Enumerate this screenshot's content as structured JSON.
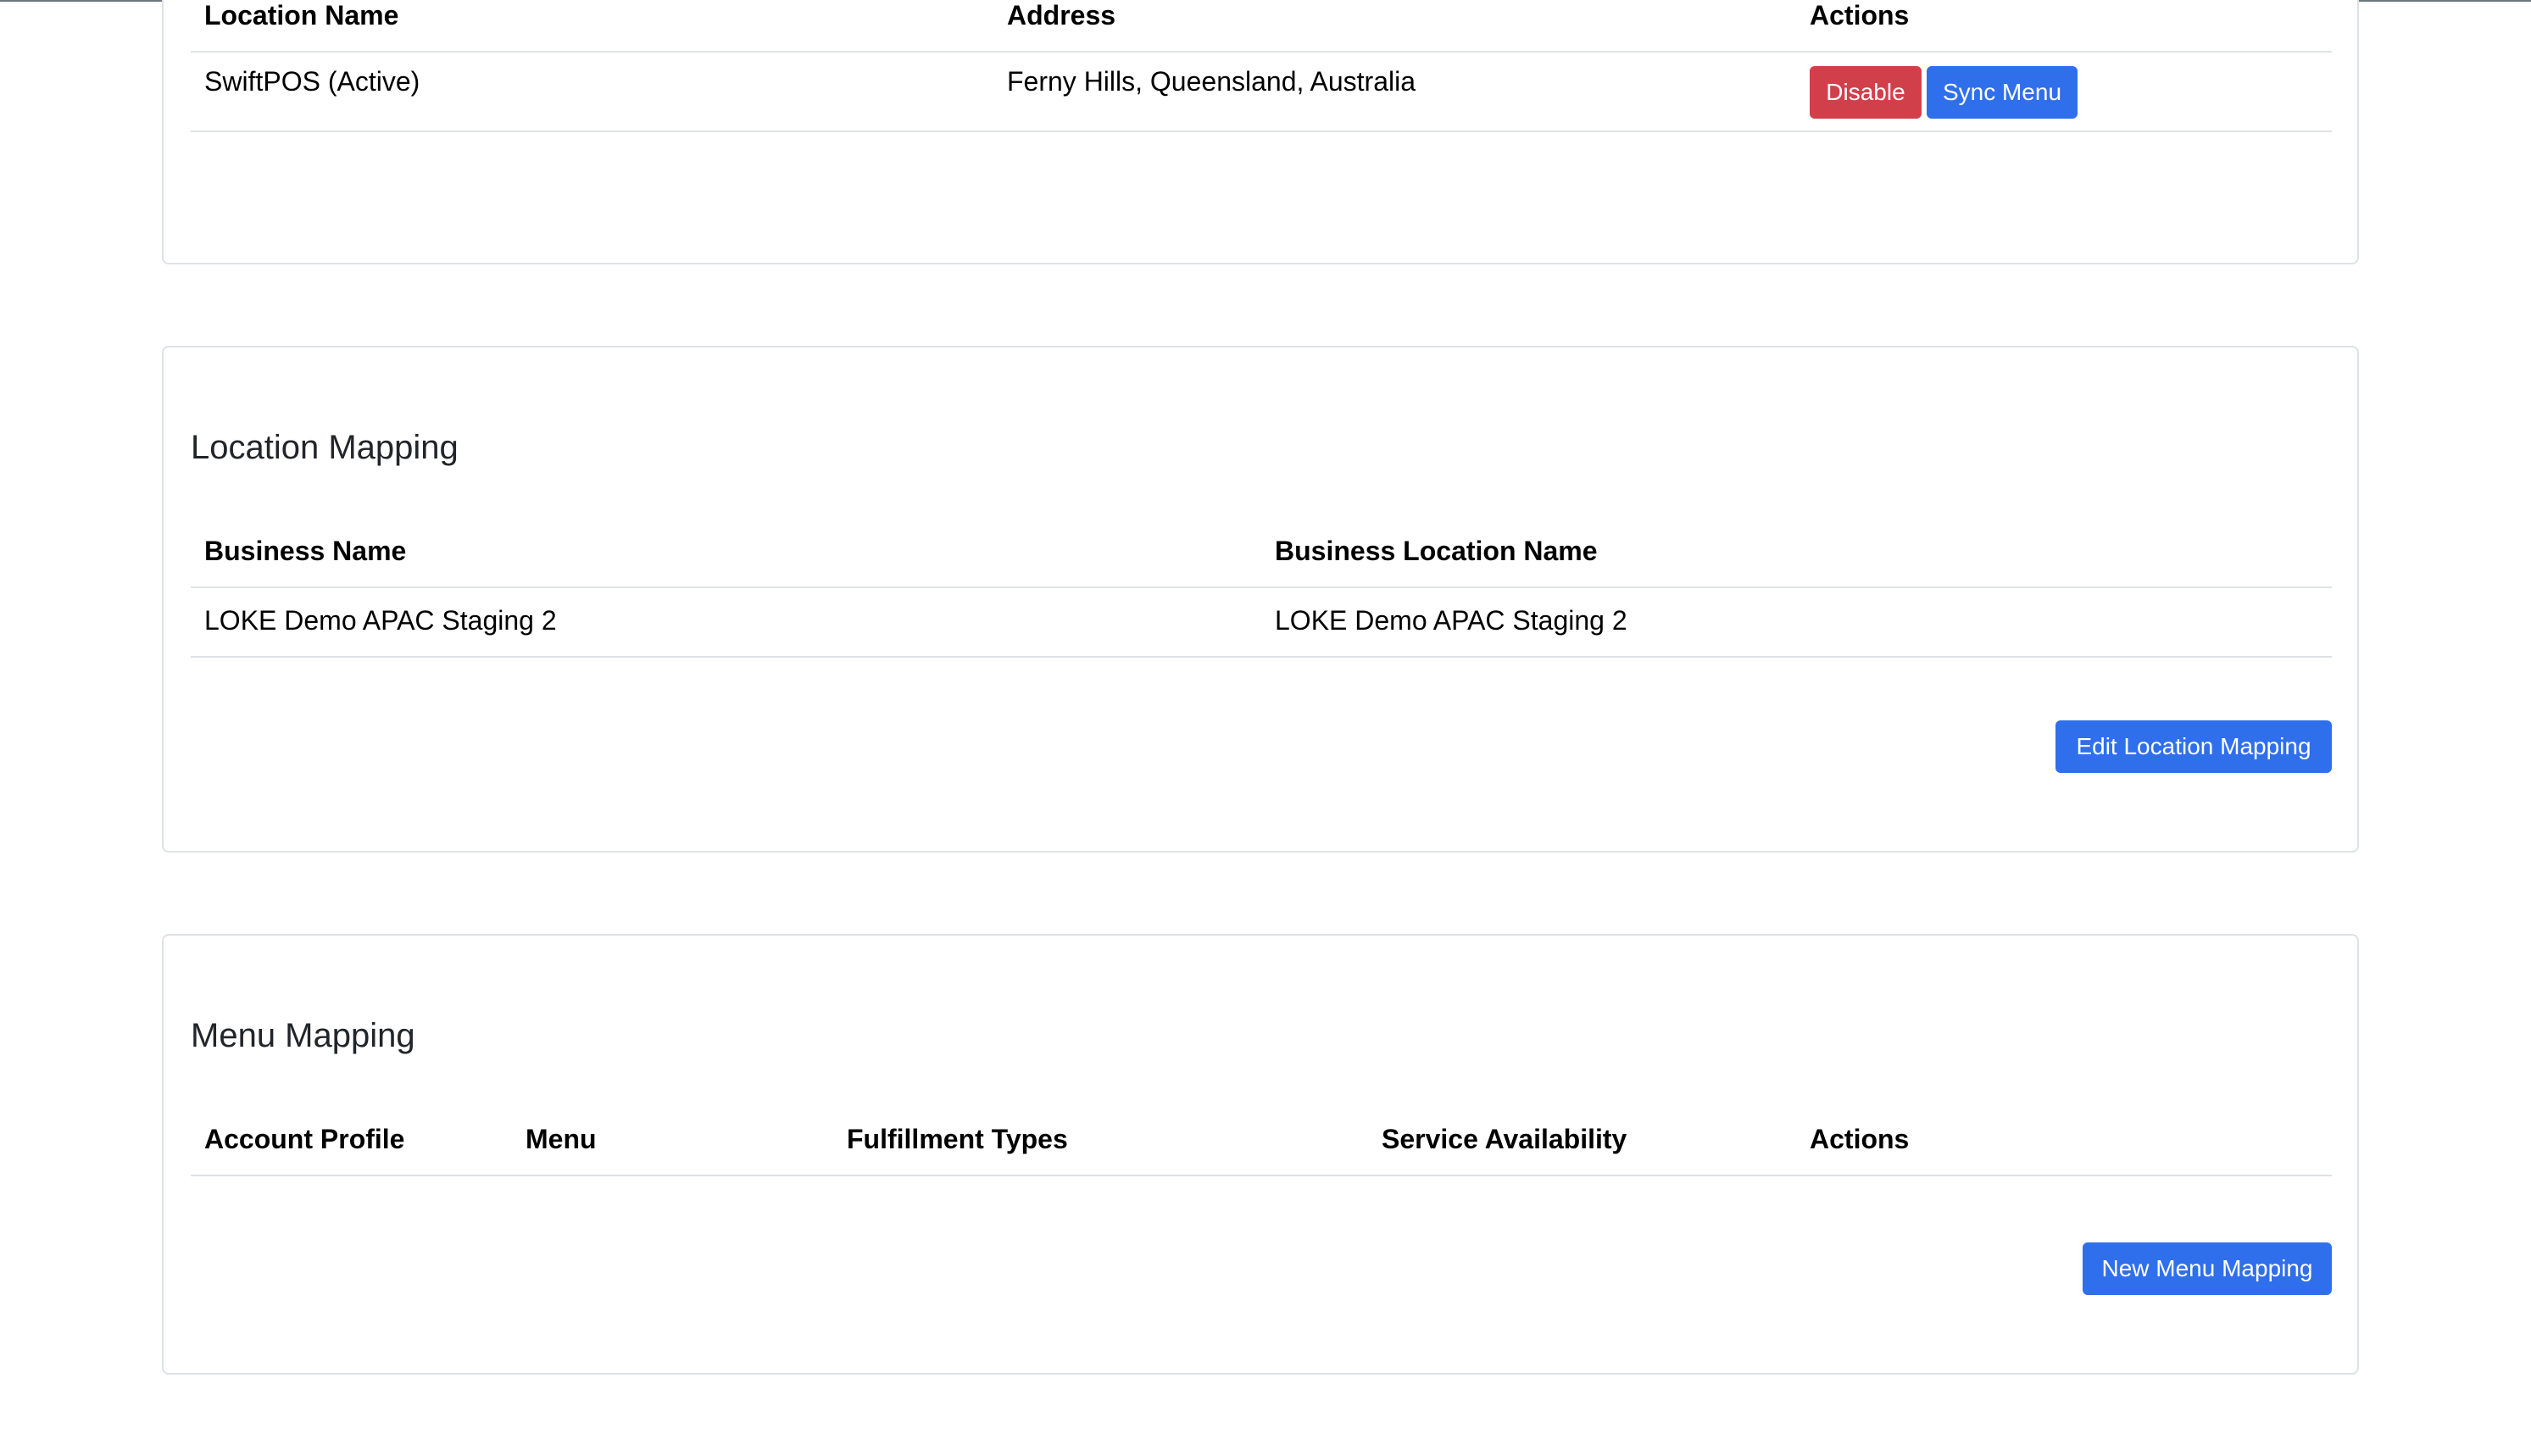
{
  "locations": {
    "columns": [
      "Location Name",
      "Address",
      "Actions"
    ],
    "rows": [
      {
        "name": "SwiftPOS (Active)",
        "address": "Ferny Hills, Queensland, Australia",
        "disable_label": "Disable",
        "sync_label": "Sync Menu"
      }
    ]
  },
  "location_mapping": {
    "title": "Location Mapping",
    "columns": [
      "Business Name",
      "Business Location Name"
    ],
    "rows": [
      {
        "business_name": "LOKE Demo APAC Staging 2",
        "business_location_name": "LOKE Demo APAC Staging 2"
      }
    ],
    "edit_label": "Edit Location Mapping"
  },
  "menu_mapping": {
    "title": "Menu Mapping",
    "columns": [
      "Account Profile",
      "Menu",
      "Fulfillment Types",
      "Service Availability",
      "Actions"
    ],
    "new_label": "New Menu Mapping"
  },
  "colors": {
    "danger": "#d1404a",
    "primary": "#2f6fec",
    "border": "#dee2e6"
  }
}
